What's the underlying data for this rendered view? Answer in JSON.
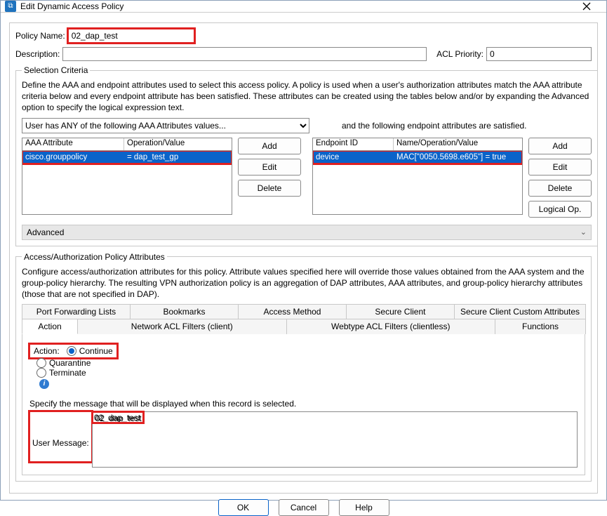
{
  "window": {
    "title": "Edit Dynamic Access Policy"
  },
  "labels": {
    "policy_name": "Policy Name:",
    "description": "Description:",
    "acl_priority": "ACL Priority:"
  },
  "policy": {
    "name": "02_dap_test",
    "description": "",
    "acl_priority": "0"
  },
  "selection": {
    "legend": "Selection Criteria",
    "desc": "Define the AAA and endpoint attributes used to select this access policy. A policy is used when a user's authorization attributes match the AAA attribute criteria below and every endpoint attribute has been satisfied. These attributes can be created using the tables below and/or by expanding the Advanced option to specify the logical expression text.",
    "match_mode": "User has ANY of the following AAA Attributes values...",
    "right_label": "and the following endpoint attributes are satisfied.",
    "aaa_table": {
      "cols": [
        "AAA Attribute",
        "Operation/Value"
      ],
      "rows": [
        {
          "attr": "cisco.grouppolicy",
          "op": "=   dap_test_gp"
        }
      ]
    },
    "endpoint_table": {
      "cols": [
        "Endpoint ID",
        "Name/Operation/Value"
      ],
      "rows": [
        {
          "id": "device",
          "val": "MAC[\"0050.5698.e605\"]  =  true"
        }
      ]
    },
    "buttons": {
      "add": "Add",
      "edit": "Edit",
      "delete": "Delete",
      "logical": "Logical Op."
    },
    "advanced": "Advanced"
  },
  "attrs": {
    "legend": "Access/Authorization Policy Attributes",
    "desc": "Configure access/authorization attributes for this policy. Attribute values specified here will override those values obtained from the AAA system and the group-policy hierarchy. The resulting VPN authorization policy is an aggregation of DAP attributes, AAA attributes, and group-policy hierarchy attributes (those that are not specified in DAP).",
    "tabs_row1": [
      "Port Forwarding Lists",
      "Bookmarks",
      "Access Method",
      "Secure Client",
      "Secure Client Custom Attributes"
    ],
    "tabs_row2": [
      "Action",
      "Network ACL Filters (client)",
      "Webtype ACL Filters (clientless)",
      "Functions"
    ],
    "active_tab": "Action",
    "action_label": "Action:",
    "radios": {
      "continue": "Continue",
      "quarantine": "Quarantine",
      "terminate": "Terminate"
    },
    "msg_intro": "Specify the message that will be displayed when this record is selected.",
    "user_message_label": "User Message:",
    "user_message": "02_dap_test"
  },
  "footer": {
    "ok": "OK",
    "cancel": "Cancel",
    "help": "Help"
  }
}
